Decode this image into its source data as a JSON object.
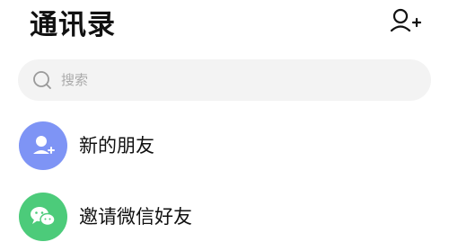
{
  "header": {
    "title": "通讯录"
  },
  "search": {
    "placeholder": "搜索"
  },
  "items": [
    {
      "label": "新的朋友",
      "icon": "person-add-icon",
      "color": "#7e94f5"
    },
    {
      "label": "邀请微信好友",
      "icon": "wechat-chat-icon",
      "color": "#4ccb7a"
    }
  ]
}
